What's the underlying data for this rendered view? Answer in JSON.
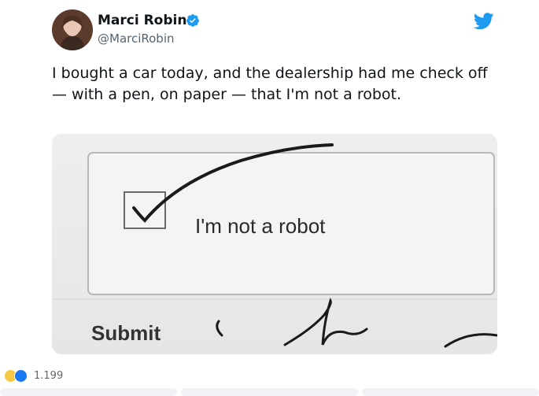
{
  "author": {
    "name": "Marci Robin",
    "handle": "@MarciRobin"
  },
  "tweet": {
    "text": "I bought a car today, and the dealership had me check off — with a pen, on paper — that I'm not a robot."
  },
  "photo": {
    "checkbox_label": "I'm not a robot",
    "submit_label": "Submit"
  },
  "reactions": {
    "count": "1.199"
  },
  "colors": {
    "twitter_blue": "#1d9bf0",
    "verified_blue": "#1d9bf0",
    "text": "#0f1419",
    "muted": "#536471"
  },
  "icons": {
    "verified": "verified-badge-icon",
    "twitter": "twitter-bird-icon"
  }
}
